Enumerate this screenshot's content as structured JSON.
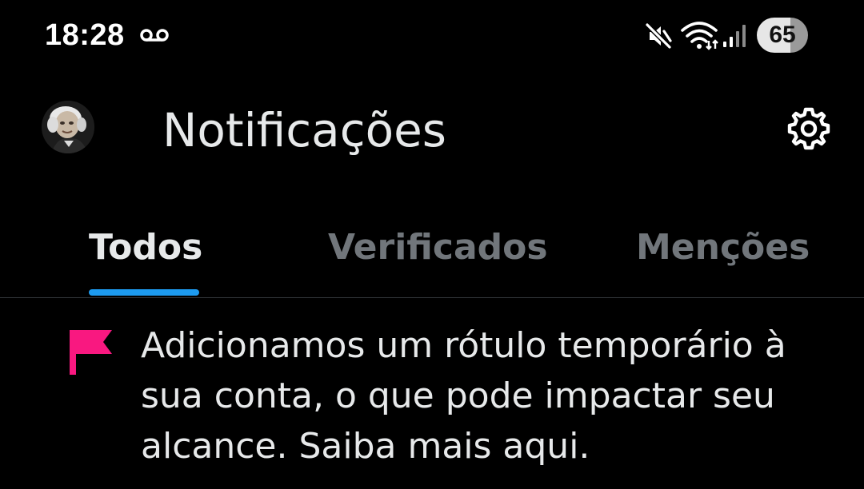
{
  "status_bar": {
    "time": "18:28",
    "battery": "65",
    "icons": [
      "voicemail-icon",
      "mute-icon",
      "wifi-icon",
      "signal-icon"
    ]
  },
  "header": {
    "title": "Notificações",
    "settings_icon": "gear-icon"
  },
  "tabs": [
    {
      "label": "Todos",
      "active": true
    },
    {
      "label": "Verificados",
      "active": false
    },
    {
      "label": "Menções",
      "active": false
    }
  ],
  "notice": {
    "icon": "flag-icon",
    "text": "Adicionamos um rótulo temporário à sua conta, o que pode impactar seu alcance. Saiba mais aqui."
  },
  "colors": {
    "background": "#000000",
    "text_primary": "#e7e9ea",
    "text_secondary": "#71767b",
    "accent": "#1d9bf0",
    "flag": "#f91880",
    "divider": "#2f3336"
  }
}
